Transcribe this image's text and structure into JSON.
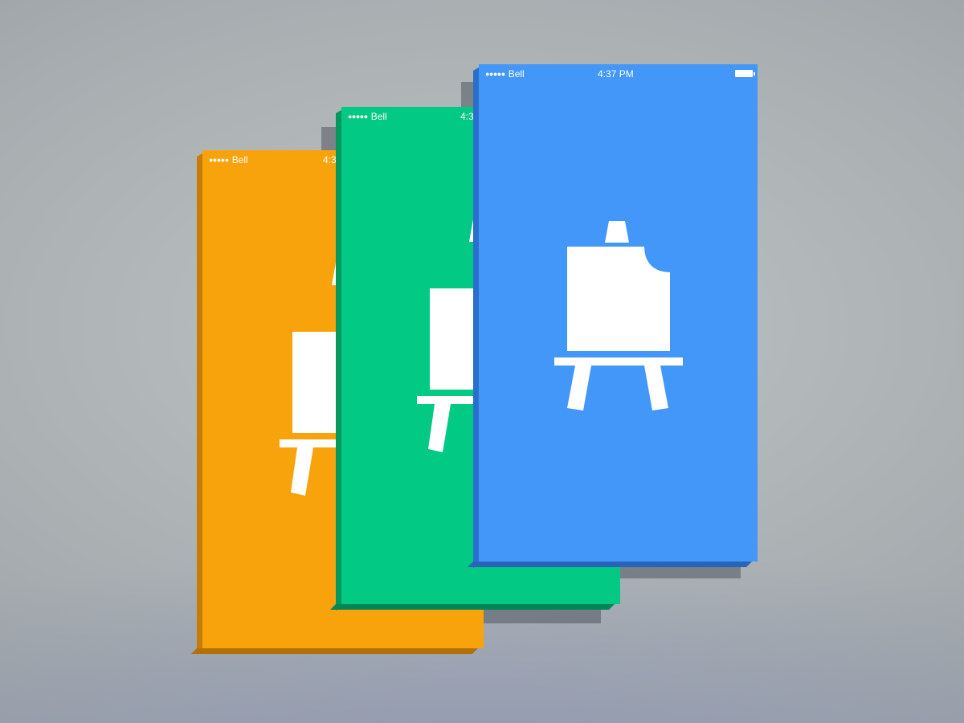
{
  "screens": [
    {
      "id": "orange",
      "color": "#f8a30b",
      "status_bar": {
        "carrier": "Bell",
        "time": "4:3"
      }
    },
    {
      "id": "green",
      "color": "#02c983",
      "status_bar": {
        "carrier": "Bell",
        "time": "4:3"
      }
    },
    {
      "id": "blue",
      "color": "#4297f8",
      "status_bar": {
        "carrier": "Bell",
        "time": "4:37 PM"
      }
    }
  ],
  "icon": "easel-icon"
}
